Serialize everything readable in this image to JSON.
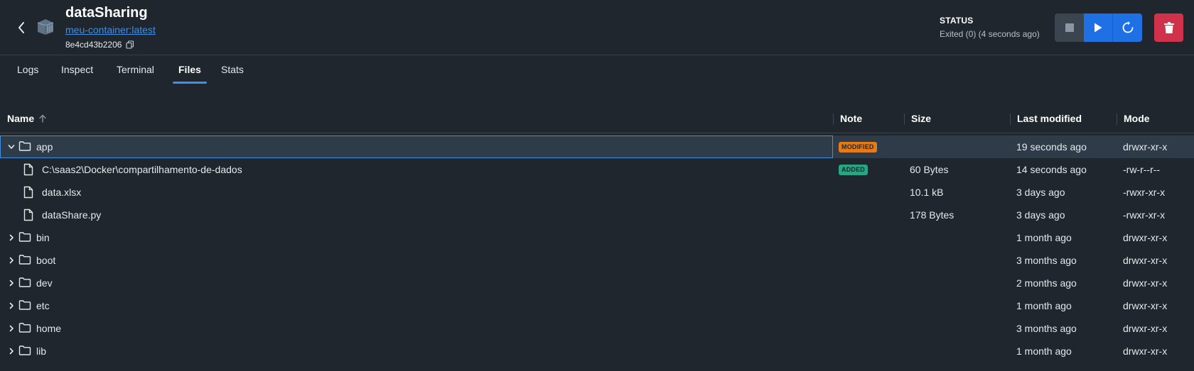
{
  "header": {
    "title": "dataSharing",
    "image": "meu-container:latest",
    "container_id": "8e4cd43b2206"
  },
  "status": {
    "label": "STATUS",
    "text": "Exited (0) (4 seconds ago)"
  },
  "colors": {
    "background": "#1f262d",
    "accent": "#1f6fe5",
    "danger": "#d0314b",
    "modified": "#e47b16",
    "added": "#2aa583"
  },
  "tabs": [
    {
      "label": "Logs"
    },
    {
      "label": "Inspect"
    },
    {
      "label": "Terminal"
    },
    {
      "label": "Files",
      "active": true
    },
    {
      "label": "Stats"
    }
  ],
  "table": {
    "columns": {
      "name": "Name",
      "note": "Note",
      "size": "Size",
      "modified": "Last modified",
      "mode": "Mode"
    },
    "sort_icon": "arrow-up-icon",
    "rows": [
      {
        "name": "app",
        "type": "folder",
        "expanded": true,
        "level": 0,
        "note": "MODIFIED",
        "size": "",
        "modified": "19 seconds ago",
        "mode": "drwxr-xr-x"
      },
      {
        "name": "C:\\saas2\\Docker\\compartilhamento-de-dados",
        "type": "file",
        "level": 1,
        "note": "ADDED",
        "size": "60 Bytes",
        "modified": "14 seconds ago",
        "mode": "-rw-r--r--"
      },
      {
        "name": "data.xlsx",
        "type": "file",
        "level": 1,
        "note": "",
        "size": "10.1 kB",
        "modified": "3 days ago",
        "mode": "-rwxr-xr-x"
      },
      {
        "name": "dataShare.py",
        "type": "file",
        "level": 1,
        "note": "",
        "size": "178 Bytes",
        "modified": "3 days ago",
        "mode": "-rwxr-xr-x"
      },
      {
        "name": "bin",
        "type": "folder",
        "expanded": false,
        "level": 0,
        "note": "",
        "size": "",
        "modified": "1 month ago",
        "mode": "drwxr-xr-x"
      },
      {
        "name": "boot",
        "type": "folder",
        "expanded": false,
        "level": 0,
        "note": "",
        "size": "",
        "modified": "3 months ago",
        "mode": "drwxr-xr-x"
      },
      {
        "name": "dev",
        "type": "folder",
        "expanded": false,
        "level": 0,
        "note": "",
        "size": "",
        "modified": "2 months ago",
        "mode": "drwxr-xr-x"
      },
      {
        "name": "etc",
        "type": "folder",
        "expanded": false,
        "level": 0,
        "note": "",
        "size": "",
        "modified": "1 month ago",
        "mode": "drwxr-xr-x"
      },
      {
        "name": "home",
        "type": "folder",
        "expanded": false,
        "level": 0,
        "note": "",
        "size": "",
        "modified": "3 months ago",
        "mode": "drwxr-xr-x"
      },
      {
        "name": "lib",
        "type": "folder",
        "expanded": false,
        "level": 0,
        "note": "",
        "size": "",
        "modified": "1 month ago",
        "mode": "drwxr-xr-x"
      }
    ]
  }
}
